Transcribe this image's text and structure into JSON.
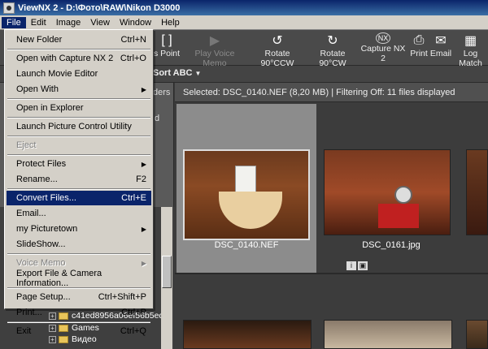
{
  "window": {
    "title": "ViewNX 2 - D:\\Фото\\RAW\\Nikon D3000"
  },
  "menubar": [
    "File",
    "Edit",
    "Image",
    "View",
    "Window",
    "Help"
  ],
  "toolbar": {
    "items": [
      {
        "label": "s Point",
        "icon": "focus-point-icon",
        "disabled": false
      },
      {
        "label": "Play Voice Memo",
        "icon": "play-icon",
        "disabled": true
      },
      {
        "label": "Rotate 90°CCW",
        "icon": "rotate-ccw-icon",
        "disabled": false
      },
      {
        "label": "Rotate 90°CW",
        "icon": "rotate-cw-icon",
        "disabled": false
      },
      {
        "label": "Capture NX 2",
        "icon": "capture-nx-icon",
        "disabled": false
      },
      {
        "label": "Print",
        "icon": "printer-icon",
        "disabled": false
      },
      {
        "label": "Email",
        "icon": "envelope-icon",
        "disabled": false
      },
      {
        "label": "Log Match",
        "icon": "log-match-icon",
        "disabled": false
      }
    ]
  },
  "sortbar": {
    "label": "Sort ABC"
  },
  "left_panel": {
    "tab_fragment": "ders",
    "side_char": "d"
  },
  "status": {
    "text": "Selected: DSC_0140.NEF (8,20 MB) | Filtering Off: 11 files displayed"
  },
  "thumbnails": [
    {
      "filename": "DSC_0140.NEF",
      "selected": true
    },
    {
      "filename": "DSC_0161.jpg",
      "selected": false
    }
  ],
  "tree": {
    "items": [
      {
        "label": "c41ed8956a06ef56b5ed6"
      },
      {
        "label": "Games"
      },
      {
        "label": "Видео"
      }
    ]
  },
  "file_menu": {
    "items": [
      {
        "label": "New Folder",
        "shortcut": "Ctrl+N"
      },
      {
        "sep": true
      },
      {
        "label": "Open with Capture NX 2",
        "shortcut": "Ctrl+O"
      },
      {
        "label": "Launch Movie Editor",
        "shortcut": ""
      },
      {
        "label": "Open With",
        "shortcut": "",
        "submenu": true
      },
      {
        "sep": true
      },
      {
        "label": "Open in Explorer",
        "shortcut": ""
      },
      {
        "sep": true
      },
      {
        "label": "Launch Picture Control Utility",
        "shortcut": ""
      },
      {
        "sep": true
      },
      {
        "label": "Eject",
        "shortcut": "",
        "disabled": true
      },
      {
        "sep": true
      },
      {
        "label": "Protect Files",
        "shortcut": "",
        "submenu": true
      },
      {
        "label": "Rename...",
        "shortcut": "F2"
      },
      {
        "sep": true
      },
      {
        "label": "Convert Files...",
        "shortcut": "Ctrl+E",
        "highlighted": true
      },
      {
        "label": "Email...",
        "shortcut": ""
      },
      {
        "label": "my Picturetown",
        "shortcut": "",
        "submenu": true
      },
      {
        "label": "SlideShow...",
        "shortcut": ""
      },
      {
        "sep": true
      },
      {
        "label": "Voice Memo",
        "shortcut": "",
        "submenu": true,
        "disabled": true
      },
      {
        "label": "Export File & Camera Information...",
        "shortcut": ""
      },
      {
        "sep": true
      },
      {
        "label": "Page Setup...",
        "shortcut": "Ctrl+Shift+P"
      },
      {
        "label": "Print...",
        "shortcut": "Ctrl+P"
      },
      {
        "sep": true
      },
      {
        "label": "Exit",
        "shortcut": "Ctrl+Q"
      }
    ]
  },
  "colors": {
    "menu_highlight": "#0a246a",
    "menu_bg": "#d4d0c8",
    "selected_cell": "#8c8c8c"
  }
}
